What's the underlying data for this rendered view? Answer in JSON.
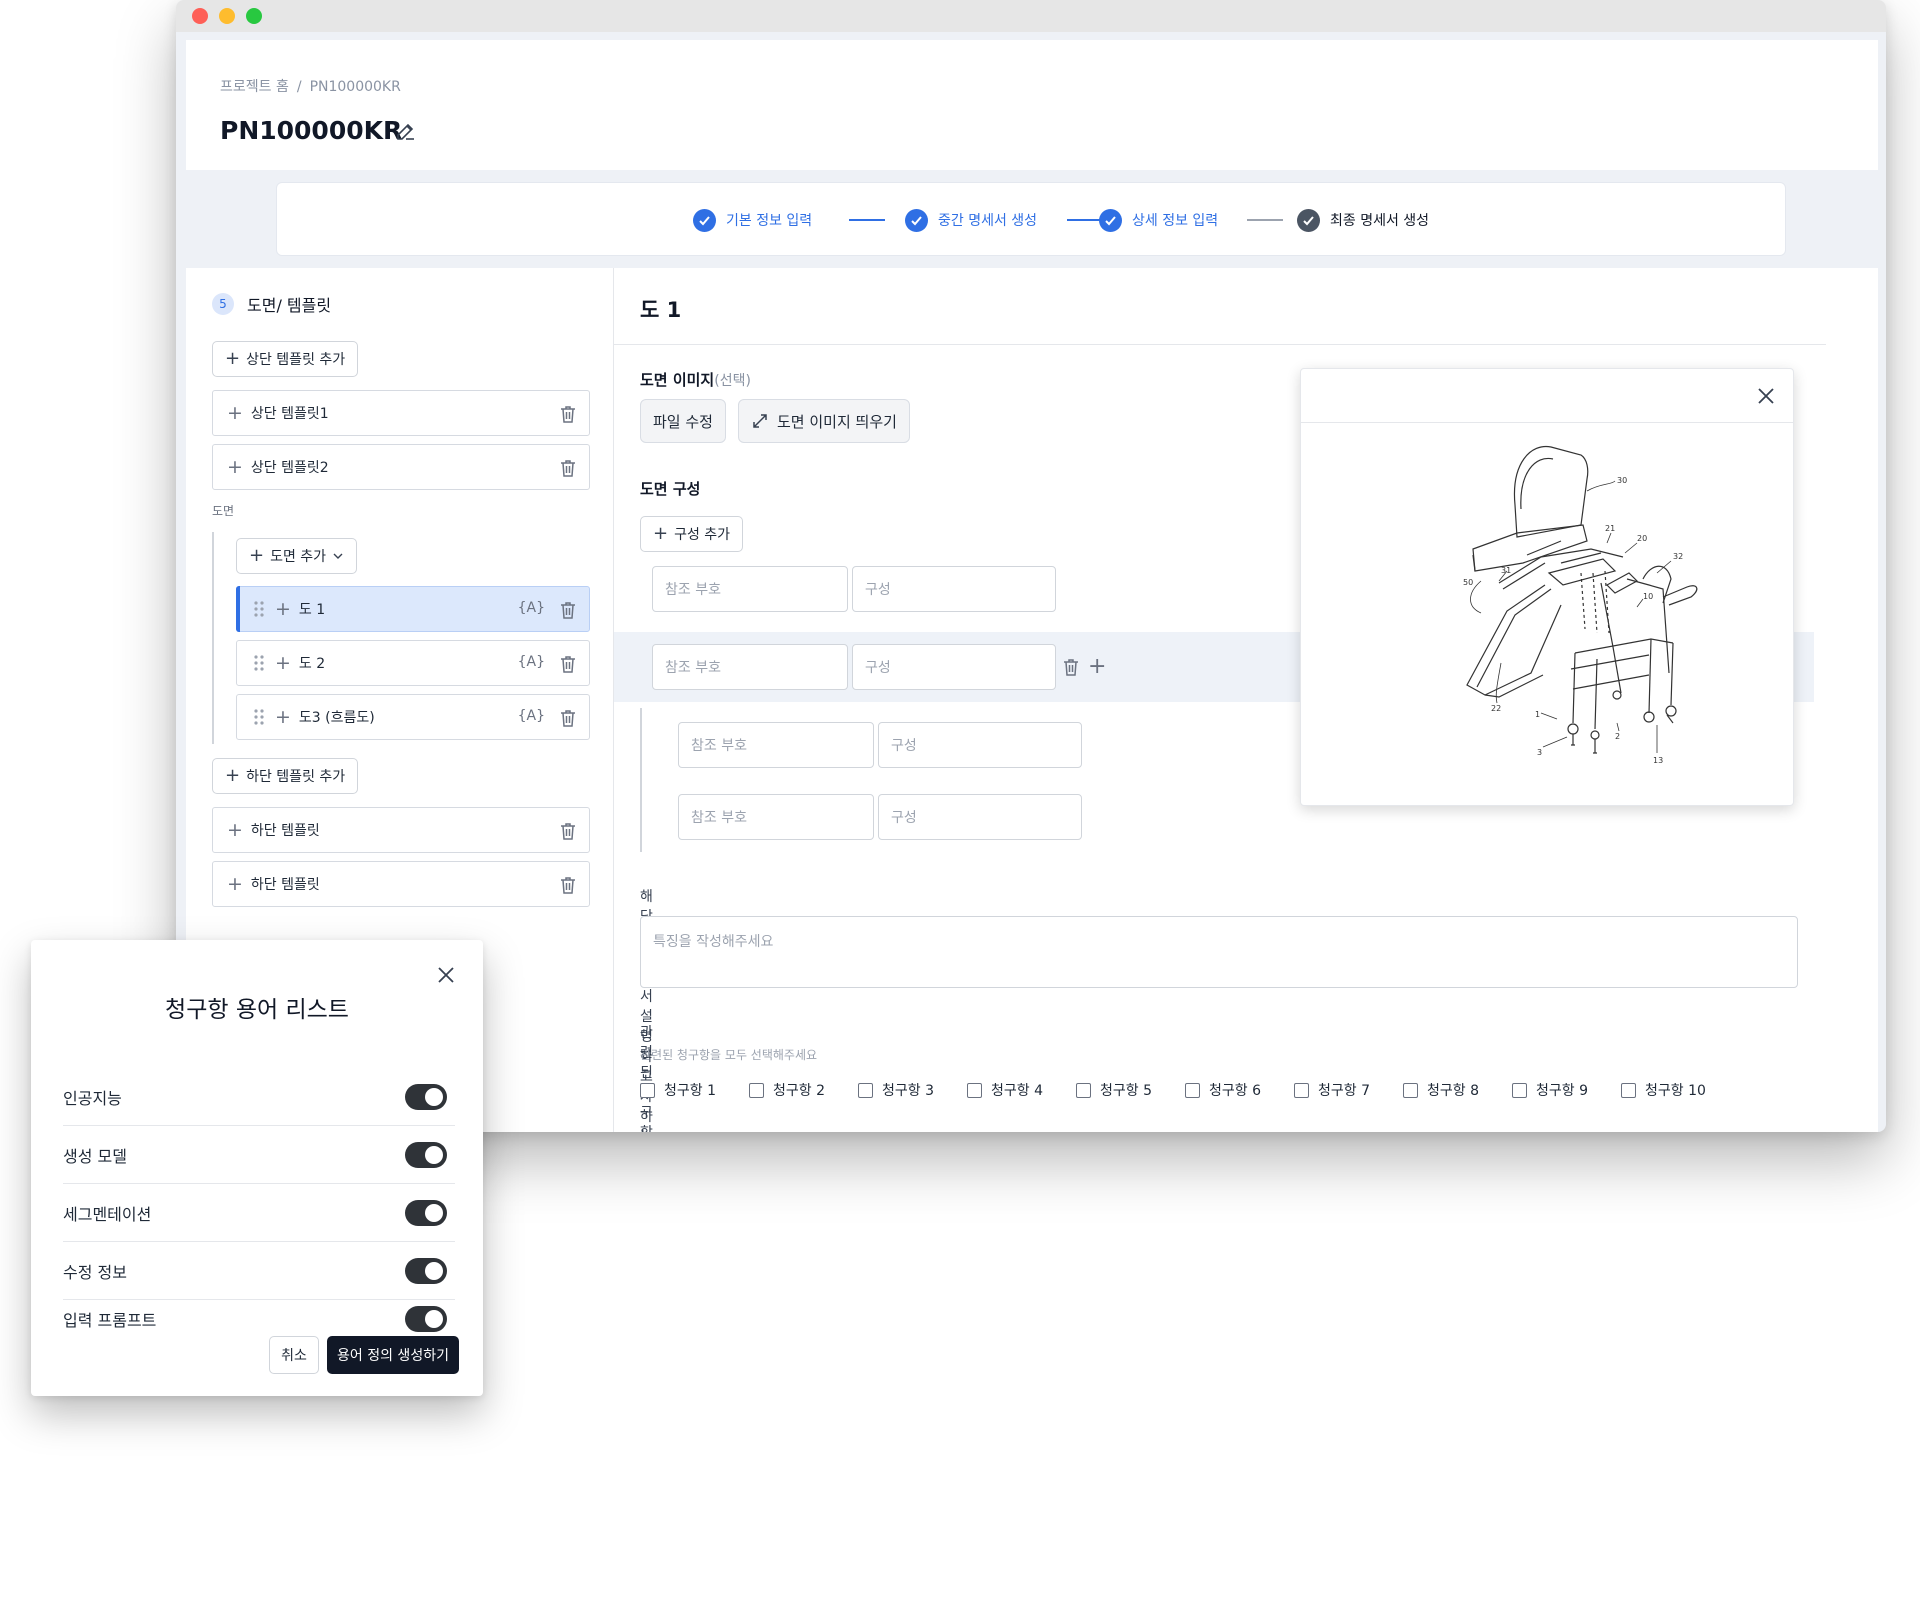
{
  "breadcrumb": {
    "home": "프로젝트 홈",
    "separator": "/",
    "current": "PN100000KR"
  },
  "page": {
    "title": "PN100000KR"
  },
  "stepper": {
    "steps": [
      {
        "label": "기본 정보 입력",
        "status": "done"
      },
      {
        "label": "중간 명세서 생성",
        "status": "done"
      },
      {
        "label": "상세 정보 입력",
        "status": "done"
      },
      {
        "label": "최종 명세서 생성",
        "status": "pending"
      }
    ]
  },
  "sidebar": {
    "section_number": "5",
    "section_title": "도면/ 템플릿",
    "add_top_template": "상단 템플릿 추가",
    "top_templates": [
      "상단 템플릿1",
      "상단 템플릿2"
    ],
    "drawings_label": "도면",
    "add_drawing": "도면 추가",
    "drawings": [
      {
        "label": "도 1",
        "fx": "{A}",
        "active": true
      },
      {
        "label": "도 2",
        "fx": "{A}",
        "active": false
      },
      {
        "label": "도3 (흐름도)",
        "fx": "{A}",
        "active": false
      }
    ],
    "add_bottom_template": "하단 템플릿 추가",
    "bottom_templates": [
      "하단 템플릿",
      "하단 템플릿"
    ]
  },
  "main": {
    "title": "도 1",
    "image_label": "도면 이미지",
    "image_optional": "(선택)",
    "edit_file": "파일 수정",
    "popup_image": "도면 이미지 띄우기",
    "composition_label": "도면 구성",
    "add_component": "구성 추가",
    "ref_placeholder": "참조 부호",
    "component_placeholder": "구성",
    "feature_label": "해당 도면에서 설명하고자 하는 특징",
    "feature_placeholder": "특징을 작성해주세요",
    "claims_label": "관련된 청구항",
    "claims_hint": "관련된 청구항을 모두 선택해주세요",
    "claims": [
      "청구항 1",
      "청구항 2",
      "청구항 3",
      "청구항 4",
      "청구항 5",
      "청구항 6",
      "청구항 7",
      "청구항 8",
      "청구항 9",
      "청구항 10"
    ]
  },
  "image_panel": {
    "ref_numbers": [
      "30",
      "21",
      "20",
      "32",
      "31",
      "50",
      "10",
      "22",
      "1",
      "2",
      "3",
      "13"
    ]
  },
  "modal": {
    "title": "청구항 용어 리스트",
    "terms": [
      {
        "label": "인공지능",
        "enabled": true
      },
      {
        "label": "생성 모델",
        "enabled": true
      },
      {
        "label": "세그멘테이션",
        "enabled": true
      },
      {
        "label": "수정 정보",
        "enabled": true
      },
      {
        "label": "입력 프롬프트",
        "enabled": true
      }
    ],
    "cancel": "취소",
    "generate": "용어 정의 생성하기"
  },
  "colors": {
    "accent": "#2f6fe4",
    "dark": "#111827",
    "active_row": "#dce8fc"
  },
  "icons": [
    "edit-icon",
    "check-icon",
    "trash-icon",
    "grip-icon",
    "expand-icon",
    "close-icon",
    "chevron-down-icon"
  ]
}
